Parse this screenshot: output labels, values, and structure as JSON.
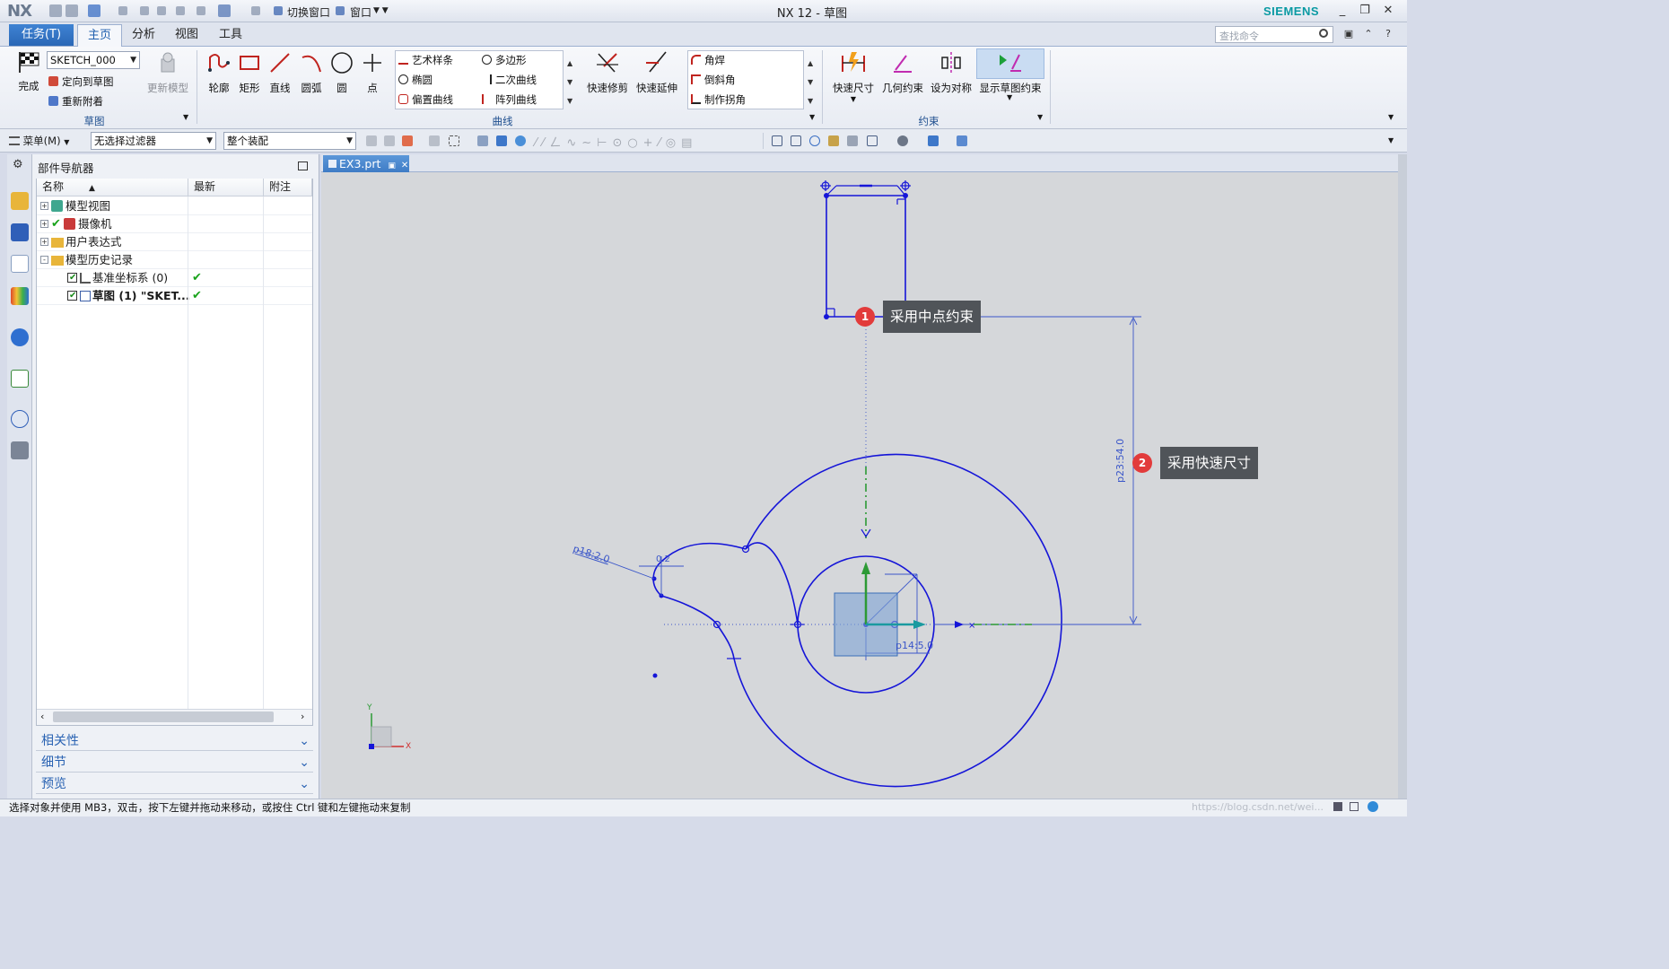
{
  "window": {
    "logo": "NX",
    "title": "NX 12 - 草图",
    "brand": "SIEMENS",
    "quick_access_switch": "切换窗口",
    "quick_access_window": "窗口"
  },
  "menu_tabs": {
    "task": "任务(T)",
    "items": [
      "主页",
      "分析",
      "视图",
      "工具"
    ],
    "active": "主页"
  },
  "search": {
    "placeholder": "查找命令"
  },
  "ribbon": {
    "sketch_group": {
      "finish": "完成",
      "sketch_name": "SKETCH_000",
      "orient": "定向到草图",
      "reattach": "重新附着",
      "update": "更新模型",
      "label": "草图"
    },
    "curve_group": {
      "profile": "轮廓",
      "rectangle": "矩形",
      "line": "直线",
      "arc": "圆弧",
      "circle": "圆",
      "point": "点",
      "gallery": [
        "艺术样条",
        "多边形",
        "椭圆",
        "二次曲线",
        "偏置曲线",
        "阵列曲线"
      ],
      "quick_trim": "快速修剪",
      "quick_extend": "快速延伸",
      "corners": [
        "角焊",
        "倒斜角",
        "制作拐角"
      ],
      "label": "曲线"
    },
    "constraint_group": {
      "rapid_dim": "快速尺寸",
      "geo_con": "几何约束",
      "symmetric": "设为对称",
      "show_con": "显示草图约束",
      "label": "约束"
    }
  },
  "filterbar": {
    "menu": "菜单(M)",
    "filter": "无选择过滤器",
    "scope": "整个装配"
  },
  "navigator": {
    "title": "部件导航器",
    "columns": [
      "名称",
      "最新",
      "附注"
    ],
    "rows": [
      {
        "label": "模型视图",
        "expand": "+",
        "check": ""
      },
      {
        "label": "摄像机",
        "expand": "+",
        "check": ""
      },
      {
        "label": "用户表达式",
        "expand": "+",
        "check": ""
      },
      {
        "label": "模型历史记录",
        "expand": "-",
        "check": ""
      },
      {
        "label": "基准坐标系 (0)",
        "expand": "",
        "check": "✔"
      },
      {
        "label": "草图 (1) \"SKET...",
        "expand": "",
        "check": "✔"
      }
    ],
    "panels": [
      "相关性",
      "细节",
      "预览"
    ]
  },
  "document": {
    "tab": "EX3.prt"
  },
  "canvas": {
    "dim_d18": "p18:2.0",
    "dim_small": "0.2",
    "dim_vertical": "p23:54.0",
    "dim_d14": "p14:5.0",
    "axis_x": "X",
    "axis_y": "Y",
    "callout1": {
      "num": "1",
      "text": "采用中点约束"
    },
    "callout2": {
      "num": "2",
      "text": "采用快速尺寸"
    },
    "sketch_color": "#1515d8",
    "dim_color": "#3a56c9"
  },
  "status": {
    "text": "选择对象并使用 MB3，双击，按下左键并拖动来移动，或按住 Ctrl 键和左键拖动来复制",
    "watermark": "https://blog.csdn.net/wei..."
  }
}
